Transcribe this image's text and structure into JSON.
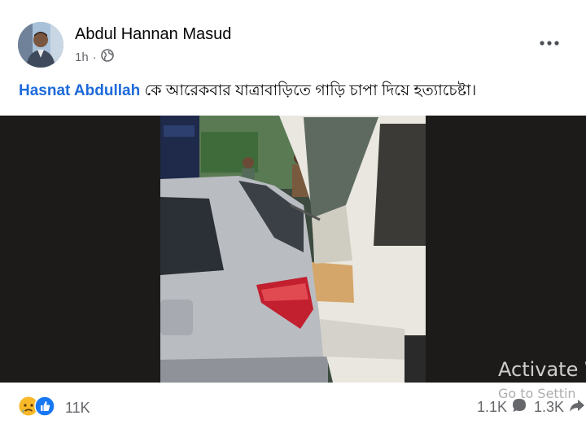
{
  "post": {
    "author": "Abdul Hannan Masud",
    "time": "1h",
    "privacy_icon": "globe-icon",
    "mention": "Hasnat Abdullah",
    "text": " কে আরেকবার যাত্রাবাড়িতে গাড়ি চাপা দিয়ে হত্যাচেষ্টা।"
  },
  "engagement": {
    "reaction_icons": [
      "sad-reaction-icon",
      "like-reaction-icon"
    ],
    "reaction_count": "11K",
    "comment_count": "1.1K",
    "share_count": "1.3K"
  },
  "watermark": {
    "line1": "Activate W",
    "line2": "Go to Settin"
  },
  "colors": {
    "mention": "#1d6ad9",
    "like_blue": "#1877f2",
    "sad_yellow": "#f7b928"
  }
}
